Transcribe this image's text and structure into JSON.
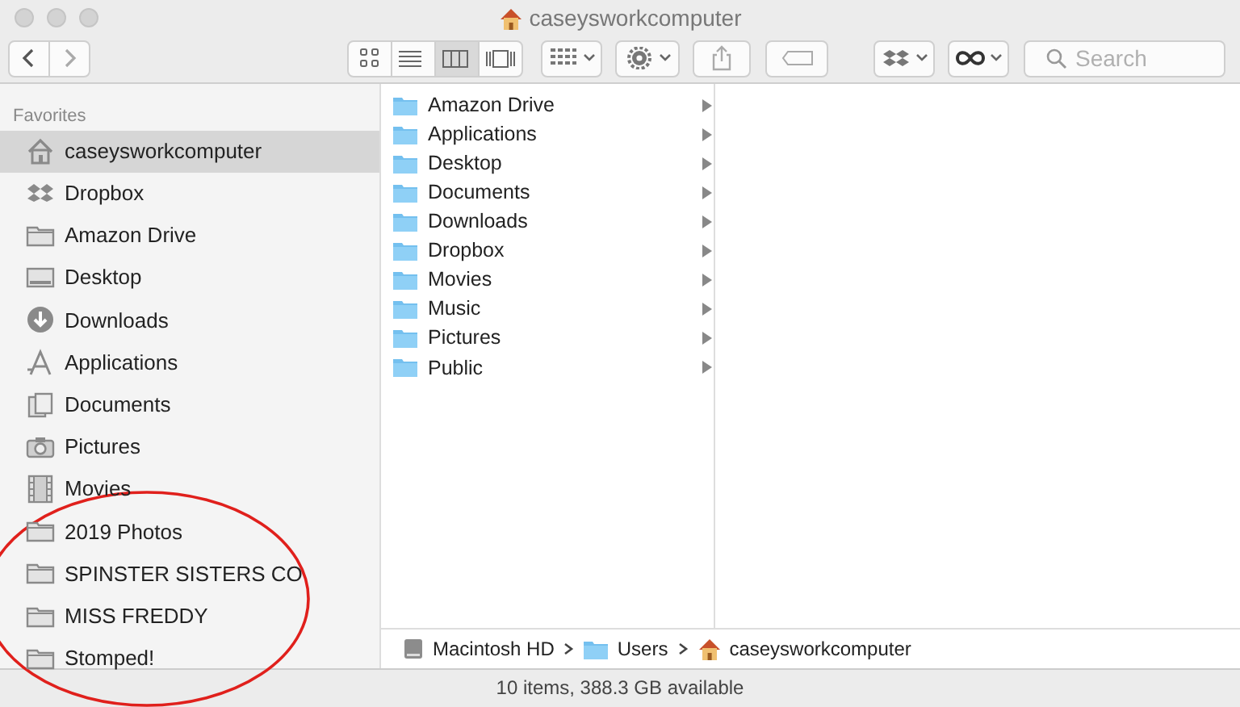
{
  "window": {
    "title": "caseysworkcomputer"
  },
  "toolbar": {
    "view_modes": [
      {
        "kind": "icons",
        "selected": false
      },
      {
        "kind": "list",
        "selected": false
      },
      {
        "kind": "columns",
        "selected": true
      },
      {
        "kind": "gallery",
        "selected": false
      }
    ],
    "search": {
      "placeholder": "Search"
    }
  },
  "sidebar": {
    "heading": "Favorites",
    "items": [
      {
        "label": "caseysworkcomputer",
        "kind": "home",
        "selected": true
      },
      {
        "label": "Dropbox",
        "kind": "dropbox",
        "selected": false
      },
      {
        "label": "Amazon Drive",
        "kind": "folder",
        "selected": false
      },
      {
        "label": "Desktop",
        "kind": "desktop",
        "selected": false
      },
      {
        "label": "Downloads",
        "kind": "downloads",
        "selected": false
      },
      {
        "label": "Applications",
        "kind": "applications",
        "selected": false
      },
      {
        "label": "Documents",
        "kind": "documents",
        "selected": false
      },
      {
        "label": "Pictures",
        "kind": "pictures",
        "selected": false
      },
      {
        "label": "Movies",
        "kind": "movies",
        "selected": false
      },
      {
        "label": "2019 Photos",
        "kind": "folder",
        "selected": false
      },
      {
        "label": "SPINSTER SISTERS CO",
        "kind": "folder",
        "selected": false
      },
      {
        "label": "MISS FREDDY",
        "kind": "folder",
        "selected": false
      },
      {
        "label": "Stomped!",
        "kind": "folder",
        "selected": false
      }
    ]
  },
  "column_1": {
    "items": [
      {
        "label": "Amazon Drive"
      },
      {
        "label": "Applications"
      },
      {
        "label": "Desktop"
      },
      {
        "label": "Documents"
      },
      {
        "label": "Downloads"
      },
      {
        "label": "Dropbox"
      },
      {
        "label": "Movies"
      },
      {
        "label": "Music"
      },
      {
        "label": "Pictures"
      },
      {
        "label": "Public"
      }
    ]
  },
  "path_bar": [
    {
      "label": "Macintosh HD",
      "kind": "disk"
    },
    {
      "label": "Users",
      "kind": "folder"
    },
    {
      "label": "caseysworkcomputer",
      "kind": "home"
    }
  ],
  "status_bar": "10 items, 388.3 GB available"
}
